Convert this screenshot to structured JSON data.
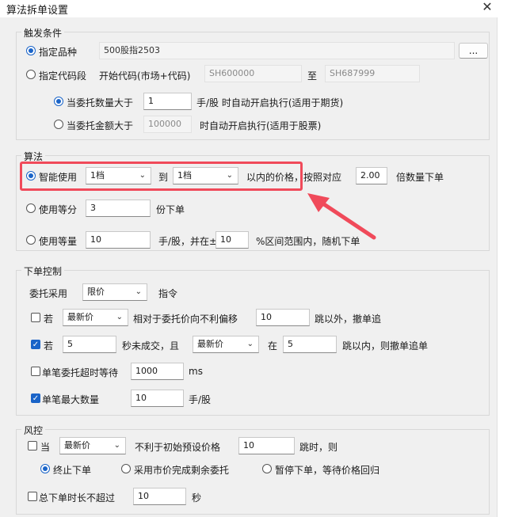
{
  "window": {
    "title": "算法拆单设置",
    "close_glyph": "✕"
  },
  "trigger": {
    "group_label": "触发条件",
    "specify_variety_label": "指定品种",
    "variety_value": "500股指2503",
    "browse_label": "...",
    "specify_code_label": "指定代码段",
    "start_code_label": "开始代码(市场+代码)",
    "start_code_value": "SH600000",
    "to_label": "至",
    "end_code_value": "SH687999",
    "qty_label": "当委托数量大于",
    "qty_value": "1",
    "qty_suffix": "手/股 时自动开启执行(适用于期货)",
    "amount_label": "当委托金额大于",
    "amount_value": "100000",
    "amount_suffix": "时自动开启执行(适用于股票)"
  },
  "algo": {
    "group_label": "算法",
    "smart_label": "智能使用",
    "smart_from": "1档",
    "smart_to_label": "到",
    "smart_to": "1档",
    "smart_price_label": "以内的价格，按照对应",
    "smart_mult_value": "2.00",
    "smart_mult_suffix": "倍数量下单",
    "equal_parts_label": "使用等分",
    "equal_parts_value": "3",
    "equal_parts_suffix": "份下单",
    "equal_qty_label": "使用等量",
    "equal_qty_value": "10",
    "equal_qty_mid": "手/股，并在±",
    "equal_qty_pct": "10",
    "equal_qty_suffix": "%区间范围内，随机下单"
  },
  "order_control": {
    "group_label": "下单控制",
    "order_type_label": "委托采用",
    "order_type_value": "限价",
    "order_type_suffix": "指令",
    "if1_label": "若",
    "if1_price": "最新价",
    "if1_mid": "相对于委托价向不利偏移",
    "if1_value": "10",
    "if1_suffix": "跳以外，撤单追",
    "if2_label": "若",
    "if2_seconds": "5",
    "if2_mid": "秒未成交，且",
    "if2_price": "最新价",
    "if2_in": "在",
    "if2_value": "5",
    "if2_suffix": "跳以内，则撤单追单",
    "timeout_label": "单笔委托超时等待",
    "timeout_value": "1000",
    "timeout_unit": "ms",
    "max_qty_label": "单笔最大数量",
    "max_qty_value": "10",
    "max_qty_unit": "手/股"
  },
  "risk": {
    "group_label": "风控",
    "when_label": "当",
    "when_price": "最新价",
    "when_mid": "不利于初始预设价格",
    "when_value": "10",
    "when_suffix": "跳时，则",
    "opt_stop": "终止下单",
    "opt_market": "采用市价完成剩余委托",
    "opt_pause": "暂停下单，等待价格回归",
    "total_time_label": "总下单时长不超过",
    "total_time_value": "10",
    "total_time_unit": "秒"
  },
  "annotation": {
    "highlight_color": "#f04a5a",
    "arrow_color": "#f04a5a"
  }
}
